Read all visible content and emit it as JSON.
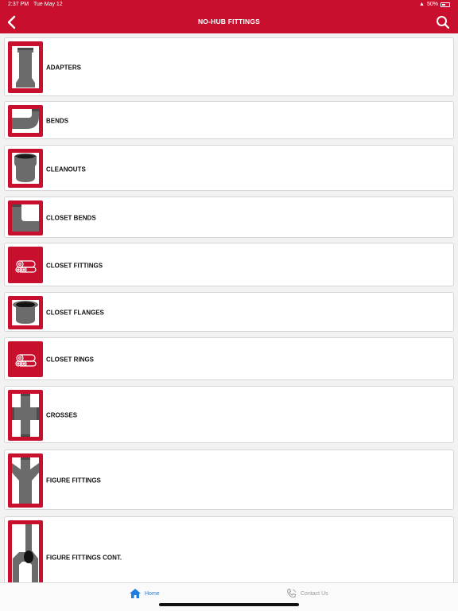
{
  "status_bar": {
    "time": "2:37 PM",
    "date": "Tue May 12",
    "battery": "50%"
  },
  "header": {
    "title": "NO-HUB FITTINGS",
    "back_icon": "chevron-left-icon",
    "search_icon": "search-icon",
    "bar_color": "#c8102e"
  },
  "items": [
    {
      "label": "ADAPTERS",
      "icon": "adapter-fitting"
    },
    {
      "label": "BENDS",
      "icon": "bend-fitting"
    },
    {
      "label": "CLEANOUTS",
      "icon": "cleanout-fitting"
    },
    {
      "label": "CLOSET BENDS",
      "icon": "closet-bend-fitting"
    },
    {
      "label": "CLOSET FITTINGS",
      "icon": "pipes-placeholder"
    },
    {
      "label": "CLOSET FLANGES",
      "icon": "closet-flange-fitting"
    },
    {
      "label": "CLOSET RINGS",
      "icon": "pipes-placeholder"
    },
    {
      "label": "CROSSES",
      "icon": "cross-fitting"
    },
    {
      "label": "FIGURE FITTINGS",
      "icon": "wye-fitting"
    },
    {
      "label": "FIGURE FITTINGS CONT.",
      "icon": "figure-fitting"
    }
  ],
  "tabbar": {
    "home": {
      "label": "Home",
      "icon": "home-icon",
      "color": "#1e7be0"
    },
    "contact": {
      "label": "Contact Us",
      "icon": "phone-icon",
      "color": "#9a9a9a"
    }
  }
}
